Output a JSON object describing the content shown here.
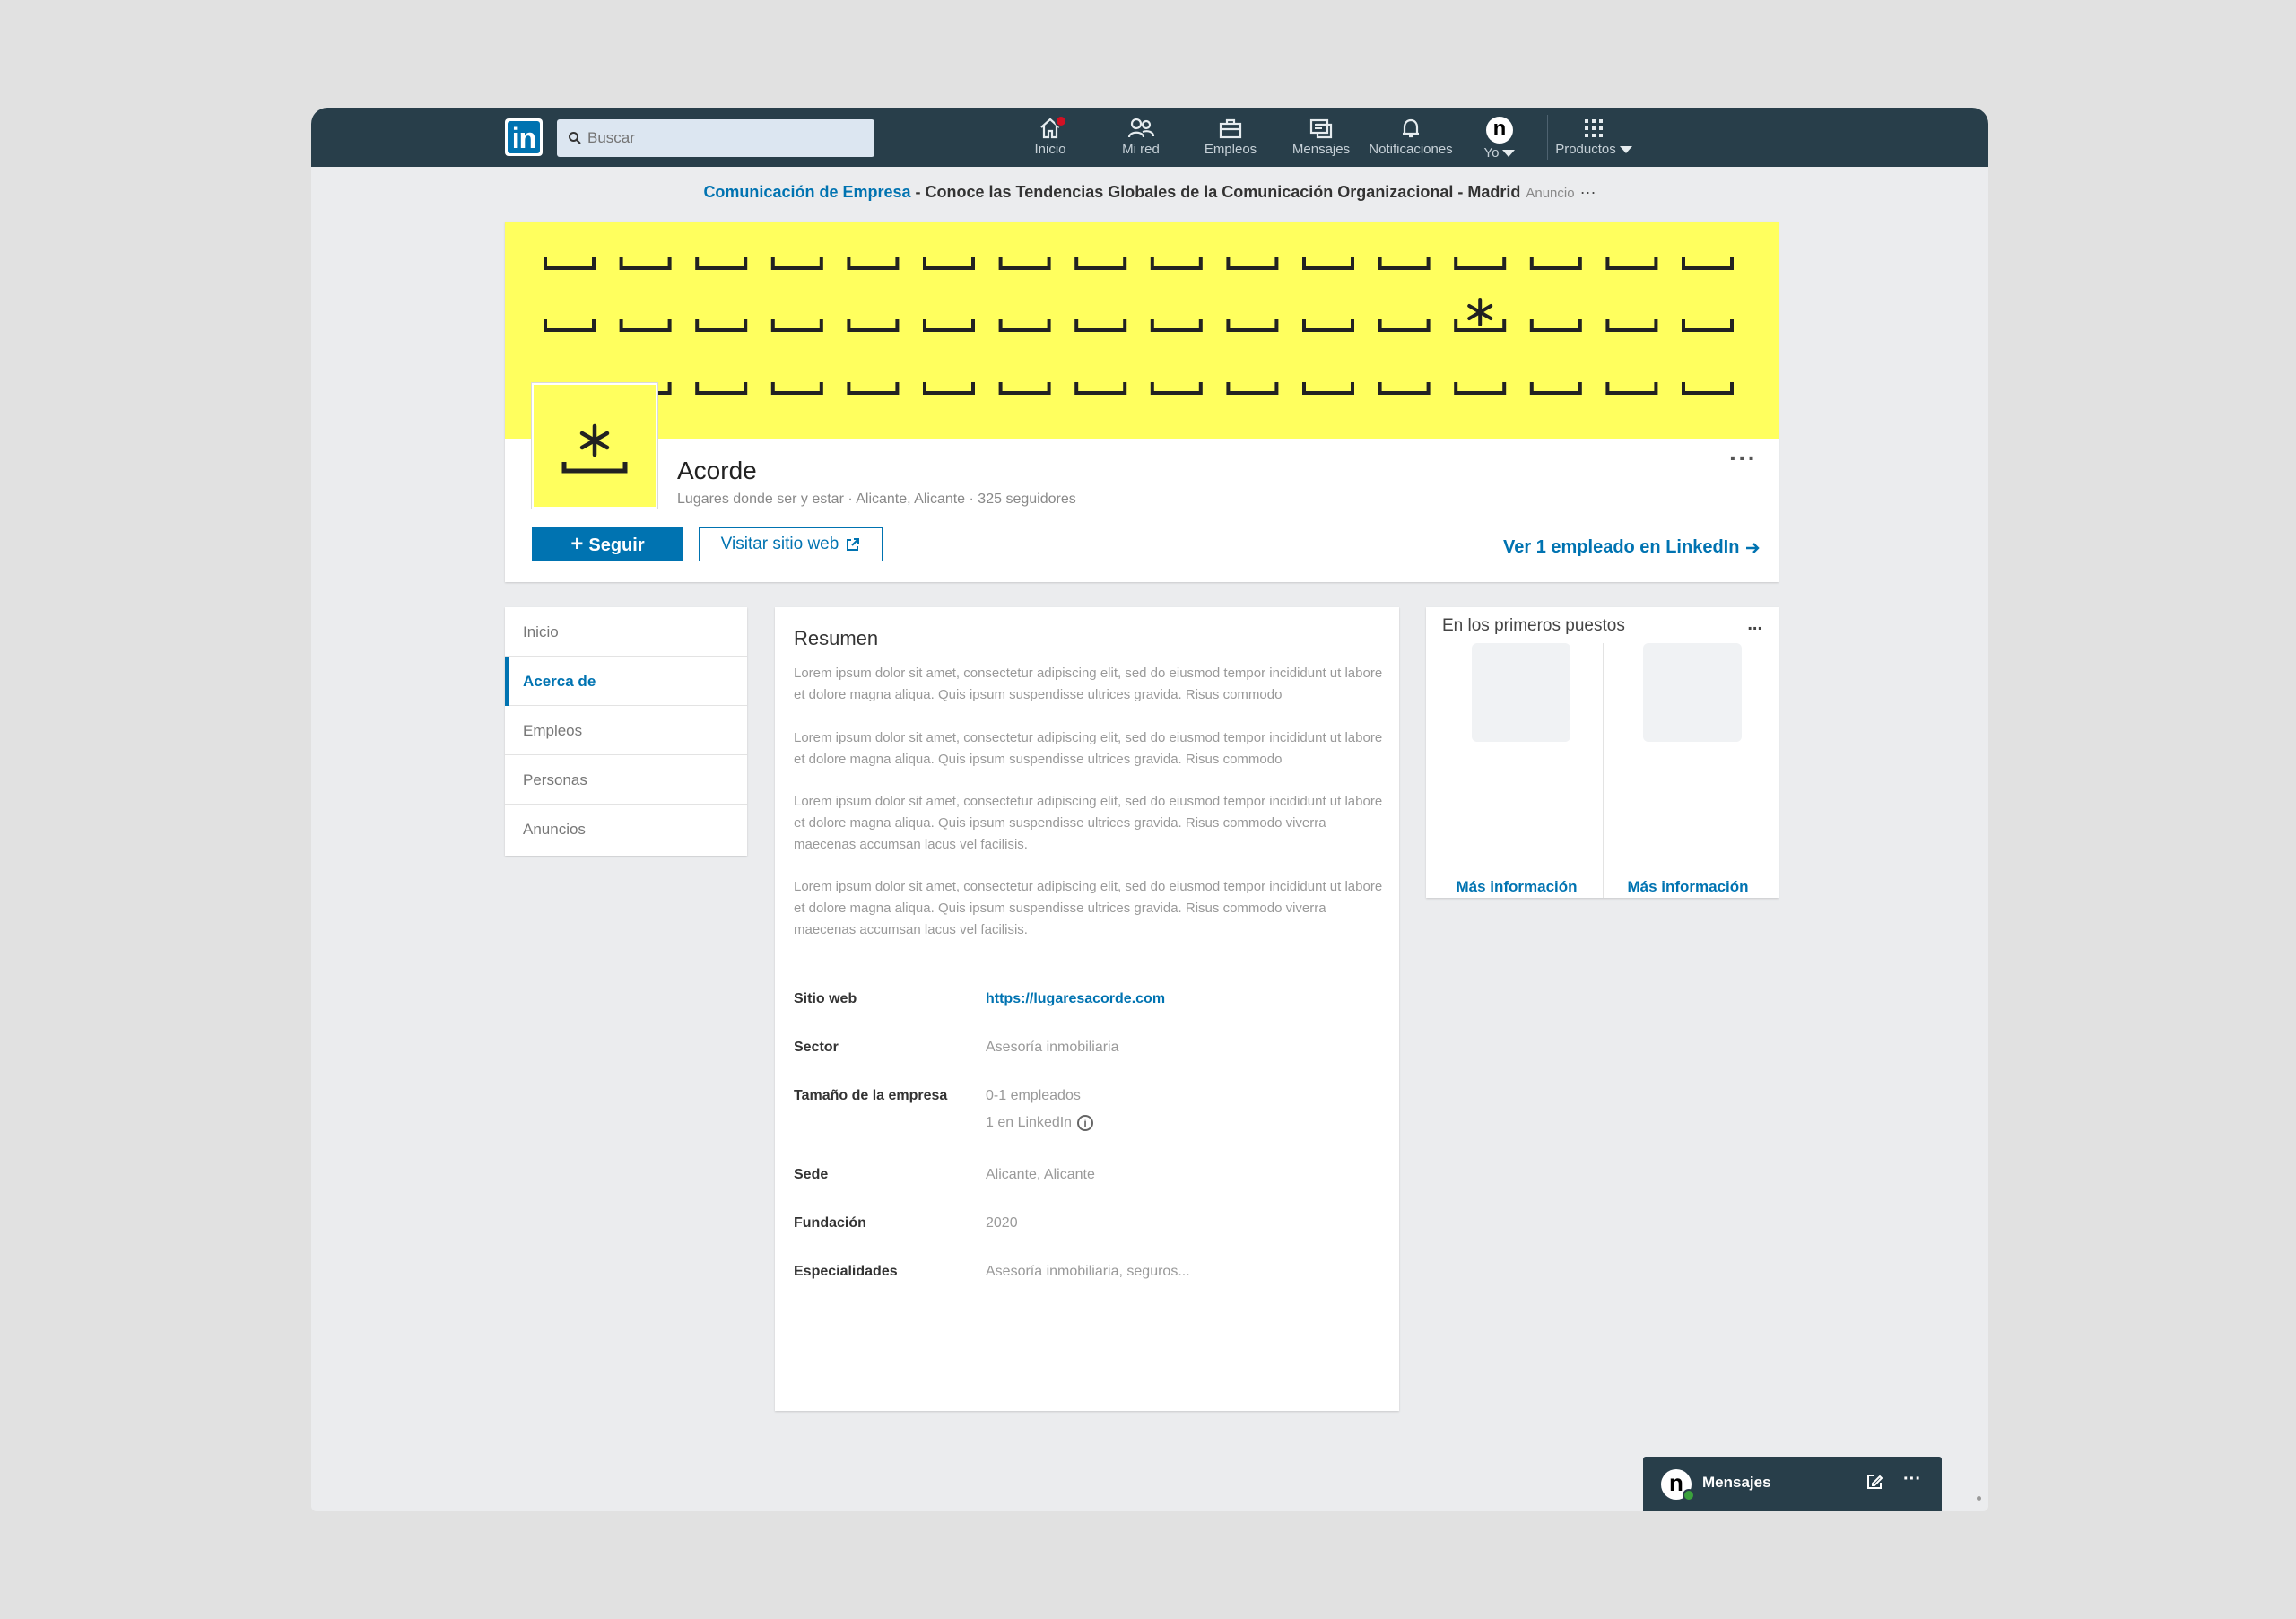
{
  "nav": {
    "search_placeholder": "Buscar",
    "items": [
      {
        "label": "Inicio",
        "icon": "home-icon"
      },
      {
        "label": "Mi red",
        "icon": "network-icon"
      },
      {
        "label": "Empleos",
        "icon": "briefcase-icon"
      },
      {
        "label": "Mensajes",
        "icon": "messages-icon"
      },
      {
        "label": "Notificaciones",
        "icon": "bell-icon"
      }
    ],
    "me_label": "Yo",
    "me_avatar": "n",
    "products_label": "Productos",
    "logo_text": "in",
    "brand_color": "#283e4a",
    "accent_color": "#0073b1"
  },
  "ad": {
    "highlight": "Comunicación de Empresa",
    "text": " - Conoce las Tendencias Globales de la Comunicación Organizacional - Madrid",
    "tag": "Anuncio",
    "more": "···"
  },
  "company": {
    "name": "Acorde",
    "meta": "Lugares donde ser y estar · Alicante, Alicante · 325 seguidores",
    "follow_label": "Seguir",
    "follow_plus": "+",
    "website_button": "Visitar sitio web",
    "employees_link": "Ver 1 empleado en LinkedIn",
    "more": "···",
    "banner_color": "#ffff5e"
  },
  "sidenav": {
    "items": [
      "Inicio",
      "Acerca de",
      "Empleos",
      "Personas",
      "Anuncios"
    ],
    "active": "Acerca de"
  },
  "about": {
    "title": "Resumen",
    "paragraphs": [
      "Lorem ipsum dolor sit amet, consectetur adipiscing elit, sed do eiusmod tempor incididunt ut labore et dolore magna aliqua. Quis ipsum suspendisse ultrices gravida. Risus commodo",
      "Lorem ipsum dolor sit amet, consectetur adipiscing elit, sed do eiusmod tempor incididunt ut labore et dolore magna aliqua. Quis ipsum suspendisse ultrices gravida. Risus commodo",
      "Lorem ipsum dolor sit amet, consectetur adipiscing elit, sed do eiusmod tempor incididunt ut labore et dolore magna aliqua. Quis ipsum suspendisse ultrices gravida. Risus commodo viverra maecenas accumsan lacus vel facilisis.",
      "Lorem ipsum dolor sit amet, consectetur adipiscing elit, sed do eiusmod tempor incididunt ut labore et dolore magna aliqua. Quis ipsum suspendisse ultrices gravida. Risus commodo viverra maecenas accumsan lacus vel facilisis."
    ],
    "details": {
      "website": {
        "label": "Sitio web",
        "value": "https://lugaresacorde.com"
      },
      "sector": {
        "label": "Sector",
        "value": "Asesoría inmobiliaria"
      },
      "size": {
        "label": "Tamaño de la empresa",
        "value": "0-1 empleados",
        "value2": "1 en LinkedIn",
        "info": "i"
      },
      "hq": {
        "label": "Sede",
        "value": "Alicante, Alicante"
      },
      "founded": {
        "label": "Fundación",
        "value": "2020"
      },
      "specialties": {
        "label": "Especialidades",
        "value": "Asesoría inmobiliaria, seguros..."
      }
    }
  },
  "tops": {
    "title": "En los primeros puestos",
    "more": "...",
    "learn_more_1": "Más información",
    "learn_more_2": "Más información"
  },
  "messaging": {
    "label": "Mensajes",
    "avatar": "n",
    "more": "···"
  }
}
